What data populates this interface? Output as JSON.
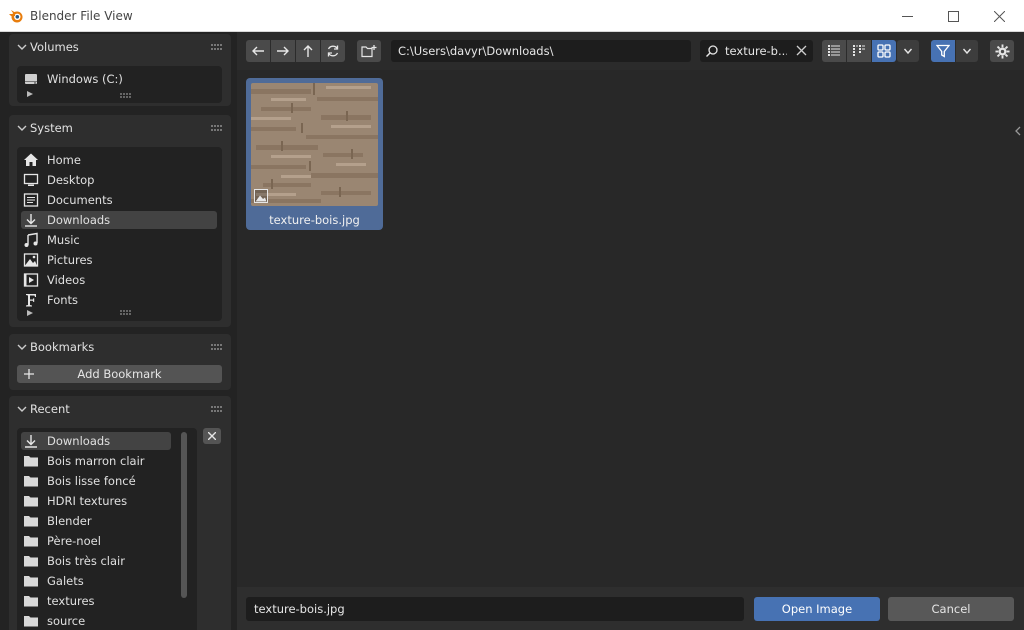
{
  "window": {
    "title": "Blender File View",
    "controls": {
      "minimize": "minimize-icon",
      "maximize": "maximize-icon",
      "close": "close-icon"
    }
  },
  "sidebar": {
    "volumes": {
      "title": "Volumes",
      "items": [
        {
          "label": "Windows (C:)",
          "icon": "drive-icon"
        }
      ]
    },
    "system": {
      "title": "System",
      "items": [
        {
          "label": "Home",
          "icon": "home-icon"
        },
        {
          "label": "Desktop",
          "icon": "desktop-icon"
        },
        {
          "label": "Documents",
          "icon": "documents-icon"
        },
        {
          "label": "Downloads",
          "icon": "download-icon",
          "active": true
        },
        {
          "label": "Music",
          "icon": "music-icon"
        },
        {
          "label": "Pictures",
          "icon": "image-icon"
        },
        {
          "label": "Videos",
          "icon": "video-icon"
        },
        {
          "label": "Fonts",
          "icon": "font-icon"
        }
      ]
    },
    "bookmarks": {
      "title": "Bookmarks",
      "add_label": "Add Bookmark"
    },
    "recent": {
      "title": "Recent",
      "items": [
        {
          "label": "Downloads",
          "icon": "download-icon",
          "active": true
        },
        {
          "label": "Bois marron clair",
          "icon": "folder-icon"
        },
        {
          "label": "Bois lisse foncé",
          "icon": "folder-icon"
        },
        {
          "label": "HDRI textures",
          "icon": "folder-icon"
        },
        {
          "label": "Blender",
          "icon": "folder-icon"
        },
        {
          "label": "Père-noel",
          "icon": "folder-icon"
        },
        {
          "label": "Bois très clair",
          "icon": "folder-icon"
        },
        {
          "label": "Galets",
          "icon": "folder-icon"
        },
        {
          "label": "textures",
          "icon": "folder-icon"
        },
        {
          "label": "source",
          "icon": "folder-icon"
        }
      ]
    }
  },
  "toolbar": {
    "path": "C:\\Users\\davyr\\Downloads\\",
    "search": "texture-bois.jpg",
    "search_visible": "texture-b..."
  },
  "files": [
    {
      "name": "texture-bois.jpg",
      "type": "image",
      "selected": true
    }
  ],
  "footer": {
    "filename": "texture-bois.jpg",
    "open_label": "Open Image",
    "cancel_label": "Cancel"
  },
  "colors": {
    "accent": "#4772b3",
    "selection": "#4f6b98"
  }
}
